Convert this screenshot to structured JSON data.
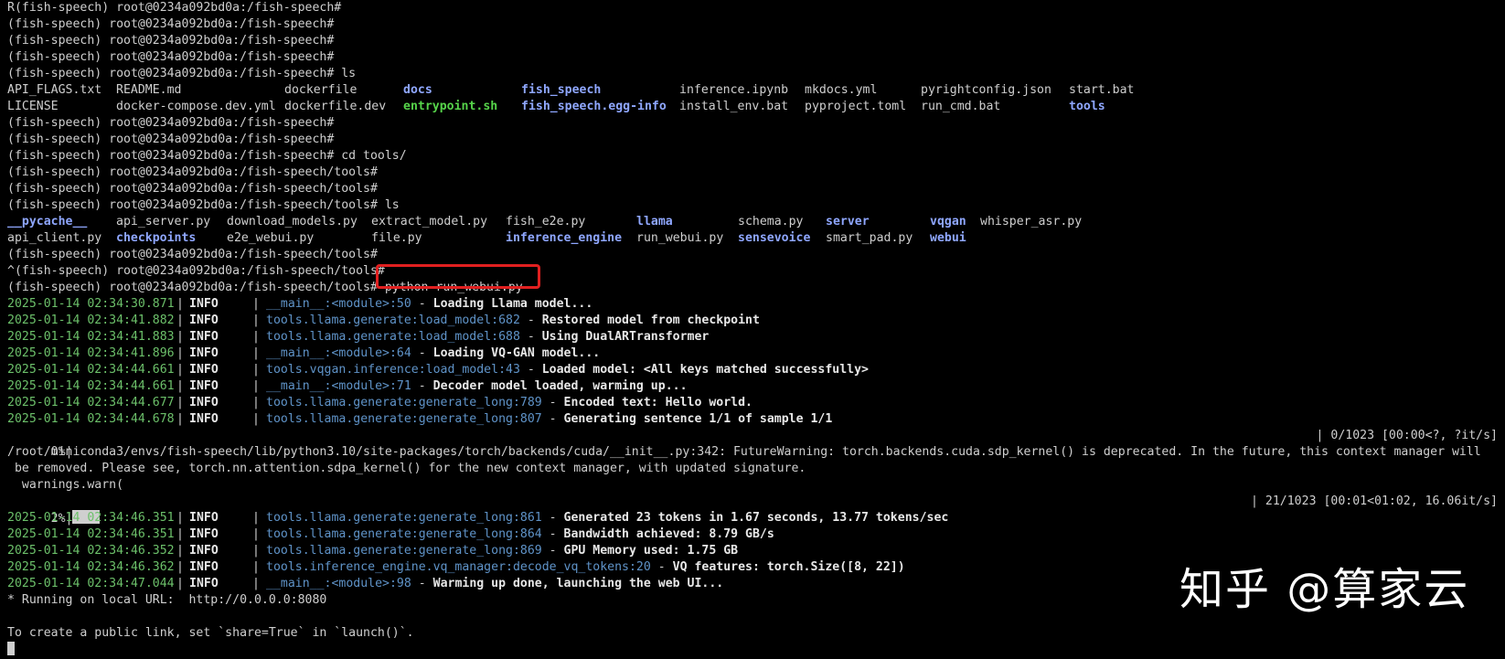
{
  "terminal": {
    "prompt_base": "(fish-speech) root@0234a092bd0a:/fish-speech#",
    "prompt_tools": "(fish-speech) root@0234a092bd0a:/fish-speech/tools#",
    "lines": {
      "l00": "R(fish-speech) root@0234a092bd0a:/fish-speech#",
      "l01": "(fish-speech) root@0234a092bd0a:/fish-speech#",
      "l02": "(fish-speech) root@0234a092bd0a:/fish-speech#",
      "l03": "(fish-speech) root@0234a092bd0a:/fish-speech#",
      "l04": "(fish-speech) root@0234a092bd0a:/fish-speech# ls",
      "l07": "(fish-speech) root@0234a092bd0a:/fish-speech#",
      "l08": "(fish-speech) root@0234a092bd0a:/fish-speech#",
      "l09": "(fish-speech) root@0234a092bd0a:/fish-speech# cd tools/",
      "l10": "(fish-speech) root@0234a092bd0a:/fish-speech/tools#",
      "l11": "(fish-speech) root@0234a092bd0a:/fish-speech/tools#",
      "l12": "(fish-speech) root@0234a092bd0a:/fish-speech/tools# ls",
      "l15": "(fish-speech) root@0234a092bd0a:/fish-speech/tools#",
      "l16": "^(fish-speech) root@0234a092bd0a:/fish-speech/tools#",
      "l17_prompt": "(fish-speech) root@0234a092bd0a:/fish-speech/tools#",
      "l17_cmd": " python run_webui.py"
    },
    "ls_root": {
      "row1": [
        "API_FLAGS.txt",
        "README.md",
        "dockerfile",
        "docs",
        "fish_speech",
        "inference.ipynb",
        "mkdocs.yml",
        "pyrightconfig.json",
        "start.bat"
      ],
      "row2": [
        "LICENSE",
        "docker-compose.dev.yml",
        "dockerfile.dev",
        "entrypoint.sh",
        "fish_speech.egg-info",
        "install_env.bat",
        "pyproject.toml",
        "run_cmd.bat",
        "tools"
      ]
    },
    "ls_tools": {
      "row1": [
        "__pycache__",
        "api_server.py",
        "download_models.py",
        "extract_model.py",
        "fish_e2e.py",
        "llama",
        "schema.py",
        "server",
        "vqgan",
        "whisper_asr.py"
      ],
      "row2": [
        "api_client.py",
        "checkpoints",
        "e2e_webui.py",
        "file.py",
        "inference_engine",
        "run_webui.py",
        "sensevoice",
        "smart_pad.py",
        "webui"
      ]
    },
    "logs1": [
      {
        "date": "2025-01-14 02:34:30.871",
        "level": "INFO",
        "module": "__main__:<module>:50",
        "msg": "Loading Llama model..."
      },
      {
        "date": "2025-01-14 02:34:41.882",
        "level": "INFO",
        "module": "tools.llama.generate:load_model:682",
        "msg": "Restored model from checkpoint"
      },
      {
        "date": "2025-01-14 02:34:41.883",
        "level": "INFO",
        "module": "tools.llama.generate:load_model:688",
        "msg": "Using DualARTransformer"
      },
      {
        "date": "2025-01-14 02:34:41.896",
        "level": "INFO",
        "module": "__main__:<module>:64",
        "msg": "Loading VQ-GAN model..."
      },
      {
        "date": "2025-01-14 02:34:44.661",
        "level": "INFO",
        "module": "tools.vqgan.inference:load_model:43",
        "msg": "Loaded model: <All keys matched successfully>"
      },
      {
        "date": "2025-01-14 02:34:44.661",
        "level": "INFO",
        "module": "__main__:<module>:71",
        "msg": "Decoder model loaded, warming up..."
      },
      {
        "date": "2025-01-14 02:34:44.677",
        "level": "INFO",
        "module": "tools.llama.generate:generate_long:789",
        "msg": "Encoded text: Hello world."
      },
      {
        "date": "2025-01-14 02:34:44.678",
        "level": "INFO",
        "module": "tools.llama.generate:generate_long:807",
        "msg": "Generating sentence 1/1 of sample 1/1"
      }
    ],
    "progress1": {
      "left": "  0%|",
      "right": "| 0/1023 [00:00<?, ?it/s]",
      "fraction": 0.0
    },
    "warning": {
      "line1": "/root/miniconda3/envs/fish-speech/lib/python3.10/site-packages/torch/backends/cuda/__init__.py:342: FutureWarning: torch.backends.cuda.sdp_kernel() is deprecated. In the future, this context manager will",
      "line2": " be removed. Please see, torch.nn.attention.sdpa_kernel() for the new context manager, with updated signature.",
      "line3": "  warnings.warn("
    },
    "progress2": {
      "left": "  2%|",
      "right": "| 21/1023 [00:01<01:02, 16.06it/s]",
      "fraction": 0.02
    },
    "logs2": [
      {
        "date": "2025-01-14 02:34:46.351",
        "level": "INFO",
        "module": "tools.llama.generate:generate_long:861",
        "msg": "Generated 23 tokens in 1.67 seconds, 13.77 tokens/sec"
      },
      {
        "date": "2025-01-14 02:34:46.351",
        "level": "INFO",
        "module": "tools.llama.generate:generate_long:864",
        "msg": "Bandwidth achieved: 8.79 GB/s"
      },
      {
        "date": "2025-01-14 02:34:46.352",
        "level": "INFO",
        "module": "tools.llama.generate:generate_long:869",
        "msg": "GPU Memory used: 1.75 GB"
      },
      {
        "date": "2025-01-14 02:34:46.362",
        "level": "INFO",
        "module": "tools.inference_engine.vq_manager:decode_vq_tokens:20",
        "msg": "VQ features: torch.Size([8, 22])"
      },
      {
        "date": "2025-01-14 02:34:47.044",
        "level": "INFO",
        "module": "__main__:<module>:98",
        "msg": "Warming up done, launching the web UI..."
      }
    ],
    "running": "* Running on local URL:  http://0.0.0.0:8080",
    "public": "To create a public link, set `share=True` in `launch()`."
  },
  "watermark": "知乎 @算家云",
  "colors": {
    "background": "#000000",
    "text": "#cfcfcf",
    "dir": "#8fa7ff",
    "exec": "#56d34a",
    "date": "#6cc06a",
    "module": "#5f93c8",
    "highlight": "#e02020"
  }
}
